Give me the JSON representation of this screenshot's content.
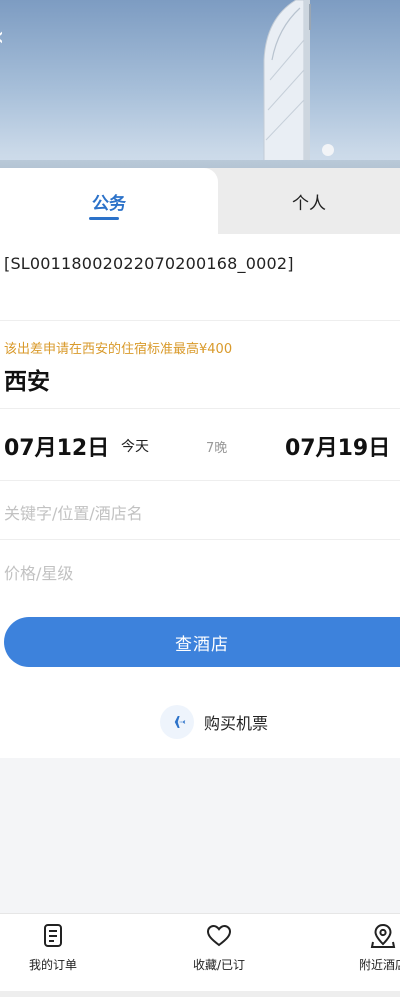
{
  "tabs": {
    "business": "公务",
    "personal": "个人"
  },
  "application": {
    "number": "[SL00118002022070200168_0002]"
  },
  "hotel_search": {
    "notice": "该出差申请在西安的住宿标准最高¥400",
    "city": "西安",
    "check_in": "07月12日",
    "check_in_tag": "今天",
    "nights": "7晚",
    "check_out": "07月19日",
    "keyword_placeholder": "关键字/位置/酒店名",
    "price_placeholder": "价格/星级",
    "search_button": "查酒店"
  },
  "flight_link": {
    "label": "购买机票",
    "icon": "airplane-icon"
  },
  "bottom_nav": {
    "items": [
      {
        "label": "我的订单",
        "icon": "order-list-icon"
      },
      {
        "label": "收藏/已订",
        "icon": "heart-icon"
      },
      {
        "label": "附近酒店",
        "icon": "map-pin-icon"
      }
    ]
  },
  "colors": {
    "accent": "#3d82dc",
    "tab_active": "#2c72c9",
    "notice": "#d99a2b"
  }
}
